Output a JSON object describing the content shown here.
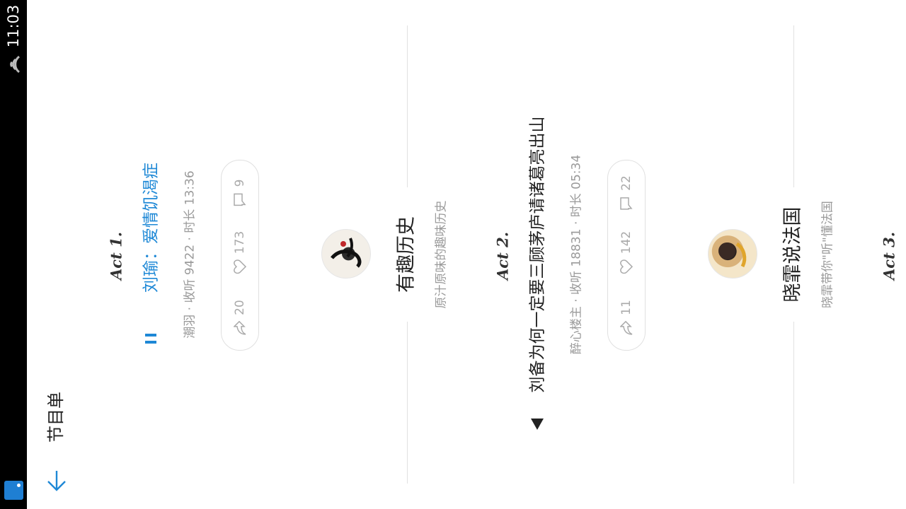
{
  "status_bar": {
    "time": "11:03",
    "wifi_icon": "wifi-icon",
    "notification_icon": "notification-icon"
  },
  "header": {
    "title": "节目单",
    "back_icon": "arrow-down-icon"
  },
  "acts": [
    {
      "label": "Act 1.",
      "title": "刘瑜：爱情饥渴症",
      "playing": true,
      "meta": "潮羽 · 收听 9422 · 时长 13:36",
      "shares": "20",
      "likes": "173",
      "comments": "9",
      "author": {
        "name": "有趣历史",
        "description": "原汁原味的趣味历史"
      }
    },
    {
      "label": "Act 2.",
      "title": "刘备为何一定要三顾茅庐请诸葛亮出山",
      "playing": false,
      "meta": "醉心楼主 · 收听 18831 · 时长 05:34",
      "shares": "11",
      "likes": "142",
      "comments": "22",
      "author": {
        "name": "晓霏说法国",
        "description": "晓霏带你\"听\"懂法国"
      }
    },
    {
      "label": "Act 3."
    }
  ],
  "colors": {
    "accent": "#1e88d6",
    "text": "#222222",
    "muted": "#9a9a9a",
    "divider": "#e1e1e1"
  }
}
